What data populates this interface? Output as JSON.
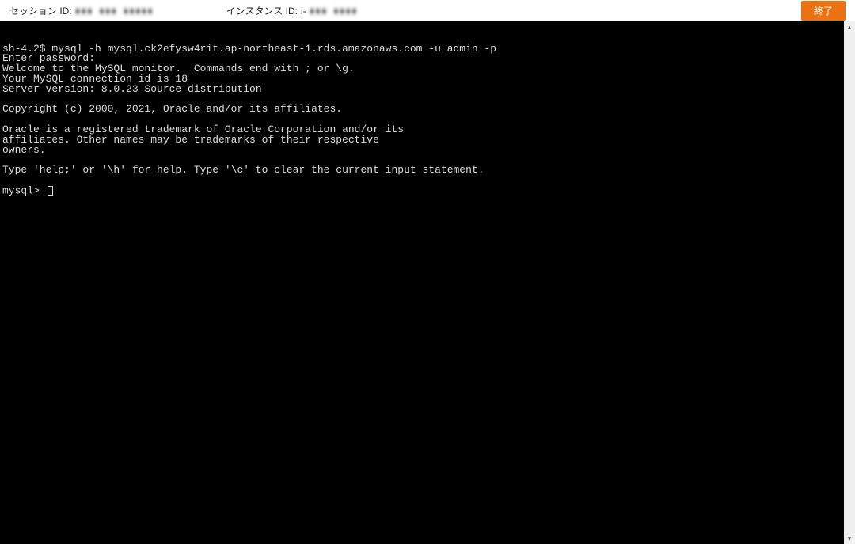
{
  "header": {
    "session_label": "セッション ID:",
    "session_id_blurred": "▮▮▮ ▮▮▮ ▮▮▮▮▮",
    "instance_label": "インスタンス ID:",
    "instance_id_prefix": "i-",
    "instance_id_blurred": "▮▮▮ ▮▮▮▮",
    "end_button": "終了"
  },
  "terminal": {
    "lines": [
      "sh-4.2$ mysql -h mysql.ck2efysw4rit.ap-northeast-1.rds.amazonaws.com -u admin -p",
      "Enter password:",
      "Welcome to the MySQL monitor.  Commands end with ; or \\g.",
      "Your MySQL connection id is 18",
      "Server version: 8.0.23 Source distribution",
      "",
      "Copyright (c) 2000, 2021, Oracle and/or its affiliates.",
      "",
      "Oracle is a registered trademark of Oracle Corporation and/or its",
      "affiliates. Other names may be trademarks of their respective",
      "owners.",
      "",
      "Type 'help;' or '\\h' for help. Type '\\c' to clear the current input statement.",
      ""
    ],
    "prompt": "mysql> "
  }
}
